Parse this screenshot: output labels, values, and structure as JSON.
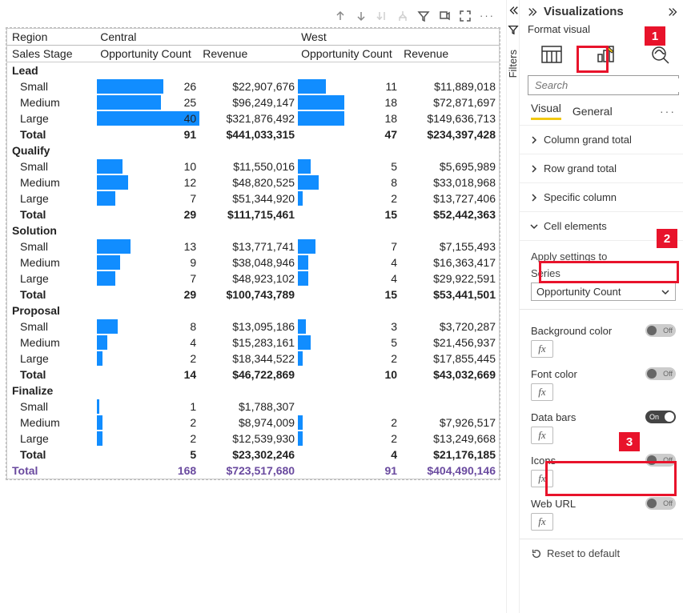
{
  "headers": {
    "region_label": "Region",
    "stage_label": "Sales Stage",
    "regions": [
      "Central",
      "West"
    ],
    "opp_label": "Opportunity Count",
    "rev_label": "Revenue"
  },
  "stages": [
    {
      "name": "Lead",
      "rows": [
        {
          "size": "Small",
          "c_opp": 26,
          "c_rev": "$22,907,676",
          "w_opp": 11,
          "w_rev": "$11,889,018"
        },
        {
          "size": "Medium",
          "c_opp": 25,
          "c_rev": "$96,249,147",
          "w_opp": 18,
          "w_rev": "$72,871,697"
        },
        {
          "size": "Large",
          "c_opp": 40,
          "c_rev": "$321,876,492",
          "w_opp": 18,
          "w_rev": "$149,636,713"
        }
      ],
      "total": {
        "c_opp": 91,
        "c_rev": "$441,033,315",
        "w_opp": 47,
        "w_rev": "$234,397,428"
      }
    },
    {
      "name": "Qualify",
      "rows": [
        {
          "size": "Small",
          "c_opp": 10,
          "c_rev": "$11,550,016",
          "w_opp": 5,
          "w_rev": "$5,695,989"
        },
        {
          "size": "Medium",
          "c_opp": 12,
          "c_rev": "$48,820,525",
          "w_opp": 8,
          "w_rev": "$33,018,968"
        },
        {
          "size": "Large",
          "c_opp": 7,
          "c_rev": "$51,344,920",
          "w_opp": 2,
          "w_rev": "$13,727,406"
        }
      ],
      "total": {
        "c_opp": 29,
        "c_rev": "$111,715,461",
        "w_opp": 15,
        "w_rev": "$52,442,363"
      }
    },
    {
      "name": "Solution",
      "rows": [
        {
          "size": "Small",
          "c_opp": 13,
          "c_rev": "$13,771,741",
          "w_opp": 7,
          "w_rev": "$7,155,493"
        },
        {
          "size": "Medium",
          "c_opp": 9,
          "c_rev": "$38,048,946",
          "w_opp": 4,
          "w_rev": "$16,363,417"
        },
        {
          "size": "Large",
          "c_opp": 7,
          "c_rev": "$48,923,102",
          "w_opp": 4,
          "w_rev": "$29,922,591"
        }
      ],
      "total": {
        "c_opp": 29,
        "c_rev": "$100,743,789",
        "w_opp": 15,
        "w_rev": "$53,441,501"
      }
    },
    {
      "name": "Proposal",
      "rows": [
        {
          "size": "Small",
          "c_opp": 8,
          "c_rev": "$13,095,186",
          "w_opp": 3,
          "w_rev": "$3,720,287"
        },
        {
          "size": "Medium",
          "c_opp": 4,
          "c_rev": "$15,283,161",
          "w_opp": 5,
          "w_rev": "$21,456,937"
        },
        {
          "size": "Large",
          "c_opp": 2,
          "c_rev": "$18,344,522",
          "w_opp": 2,
          "w_rev": "$17,855,445"
        }
      ],
      "total": {
        "c_opp": 14,
        "c_rev": "$46,722,869",
        "w_opp": 10,
        "w_rev": "$43,032,669"
      }
    },
    {
      "name": "Finalize",
      "rows": [
        {
          "size": "Small",
          "c_opp": 1,
          "c_rev": "$1,788,307",
          "w_opp": null,
          "w_rev": ""
        },
        {
          "size": "Medium",
          "c_opp": 2,
          "c_rev": "$8,974,009",
          "w_opp": 2,
          "w_rev": "$7,926,517"
        },
        {
          "size": "Large",
          "c_opp": 2,
          "c_rev": "$12,539,930",
          "w_opp": 2,
          "w_rev": "$13,249,668"
        }
      ],
      "total": {
        "c_opp": 5,
        "c_rev": "$23,302,246",
        "w_opp": 4,
        "w_rev": "$21,176,185"
      }
    }
  ],
  "total_label": "Total",
  "grand": {
    "label": "Total",
    "c_opp": 168,
    "c_rev": "$723,517,680",
    "w_opp": 91,
    "w_rev": "$404,490,146"
  },
  "bar_max": 40,
  "pane": {
    "title": "Visualizations",
    "subtitle": "Format visual",
    "filters_label": "Filters",
    "search_placeholder": "Search",
    "tab_visual": "Visual",
    "tab_general": "General",
    "acc_col_total": "Column grand total",
    "acc_row_total": "Row grand total",
    "acc_specific": "Specific column",
    "acc_cell": "Cell elements",
    "apply_to": "Apply settings to",
    "series_label": "Series",
    "series_value": "Opportunity Count",
    "opts": {
      "bg": "Background color",
      "font": "Font color",
      "bars": "Data bars",
      "icons": "Icons",
      "web": "Web URL"
    },
    "on": "On",
    "off": "Off",
    "fx": "fx",
    "reset": "Reset to default"
  },
  "callouts": {
    "1": "1",
    "2": "2",
    "3": "3"
  }
}
